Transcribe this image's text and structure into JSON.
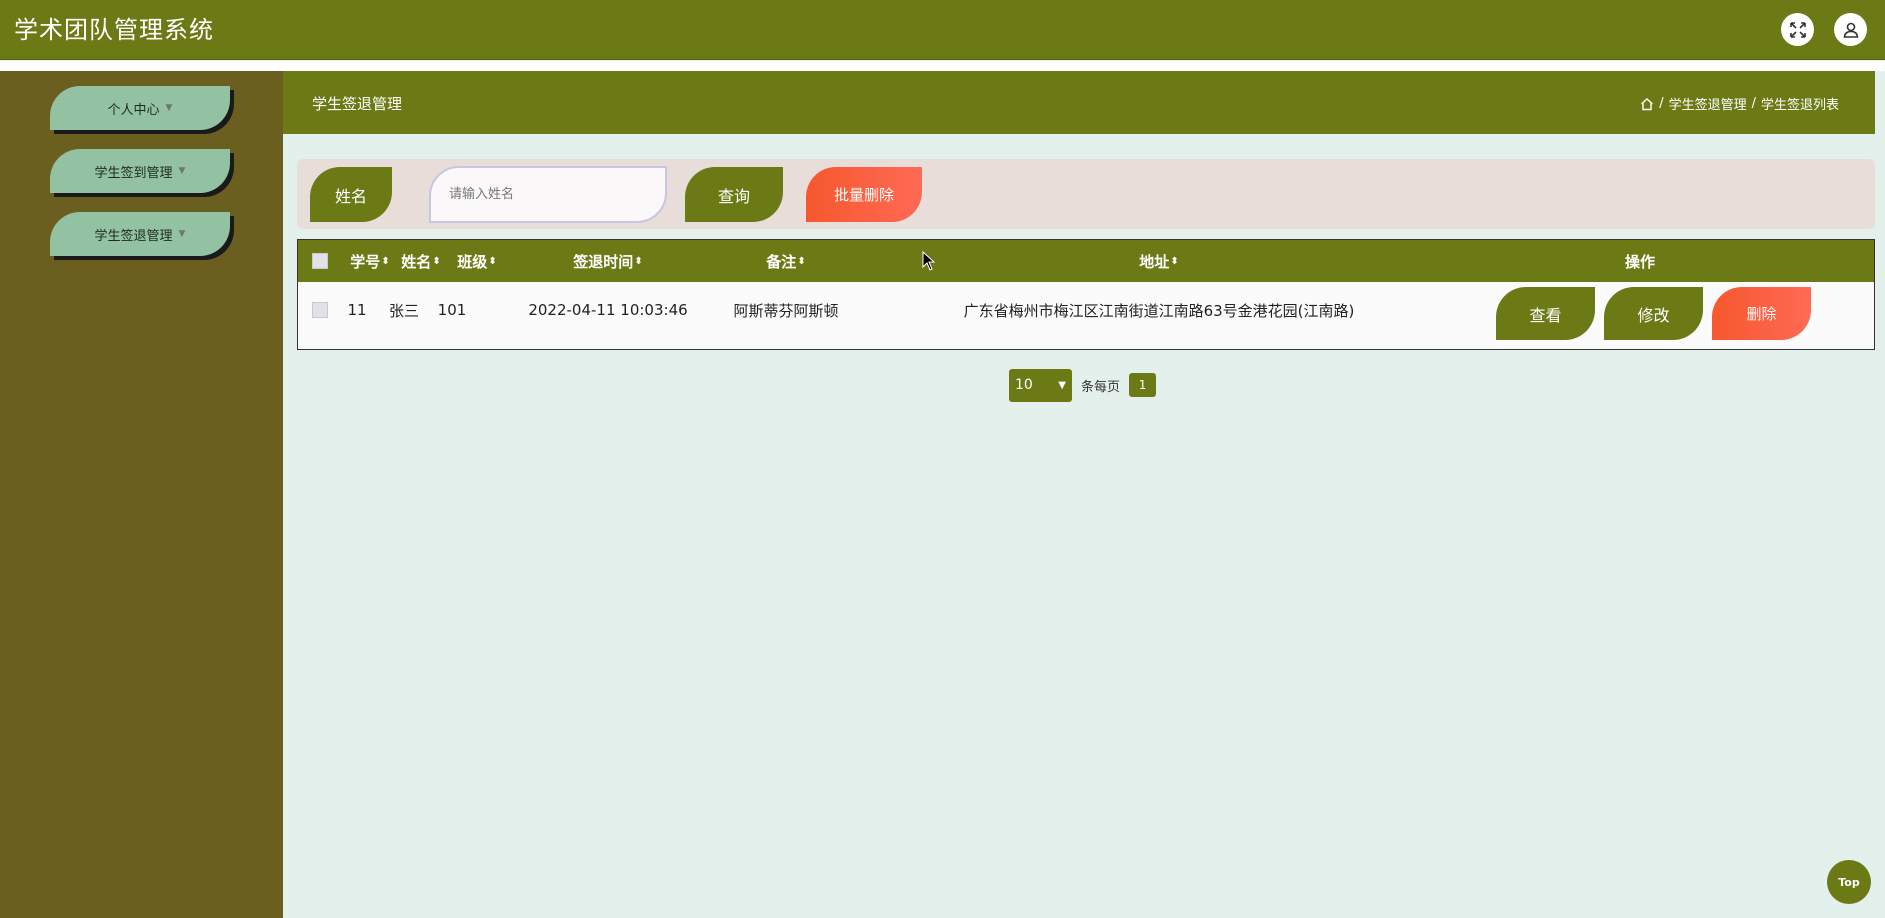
{
  "app": {
    "title": "学术团队管理系统"
  },
  "topbar_icons": {
    "fullscreen": "fullscreen-icon",
    "user": "user-icon"
  },
  "sidebar": {
    "items": [
      {
        "label": "个人中心"
      },
      {
        "label": "学生签到管理"
      },
      {
        "label": "学生签退管理"
      }
    ]
  },
  "page": {
    "title": "学生签退管理",
    "breadcrumb": [
      "学生签退管理",
      "学生签退列表"
    ],
    "breadcrumb_sep": "/"
  },
  "search": {
    "name_label": "姓名",
    "name_placeholder": "请输入姓名",
    "query_button": "查询",
    "batch_delete_button": "批量删除"
  },
  "table": {
    "columns": [
      "学号",
      "姓名",
      "班级",
      "签退时间",
      "备注",
      "地址",
      "操作"
    ],
    "sort_glyph": "⬍",
    "rows": [
      {
        "student_id": "11",
        "name": "张三",
        "class": "101",
        "signout_time": "2022-04-11 10:03:46",
        "remark": "阿斯蒂芬阿斯顿",
        "address": "广东省梅州市梅江区江南街道江南路63号金港花园(江南路)",
        "actions": {
          "view": "查看",
          "edit": "修改",
          "delete": "删除"
        }
      }
    ]
  },
  "pagination": {
    "page_size": "10",
    "per_page_label": "条每页",
    "current_page": "1"
  },
  "back_to_top": "Top",
  "colors": {
    "primary": "#6b7a15",
    "sidebar_bg": "#6b5f20",
    "sidebar_button": "#93c2a3",
    "danger": "#f6582e",
    "page_bg": "#e4f0ec",
    "search_bg": "#e8ddd8"
  }
}
